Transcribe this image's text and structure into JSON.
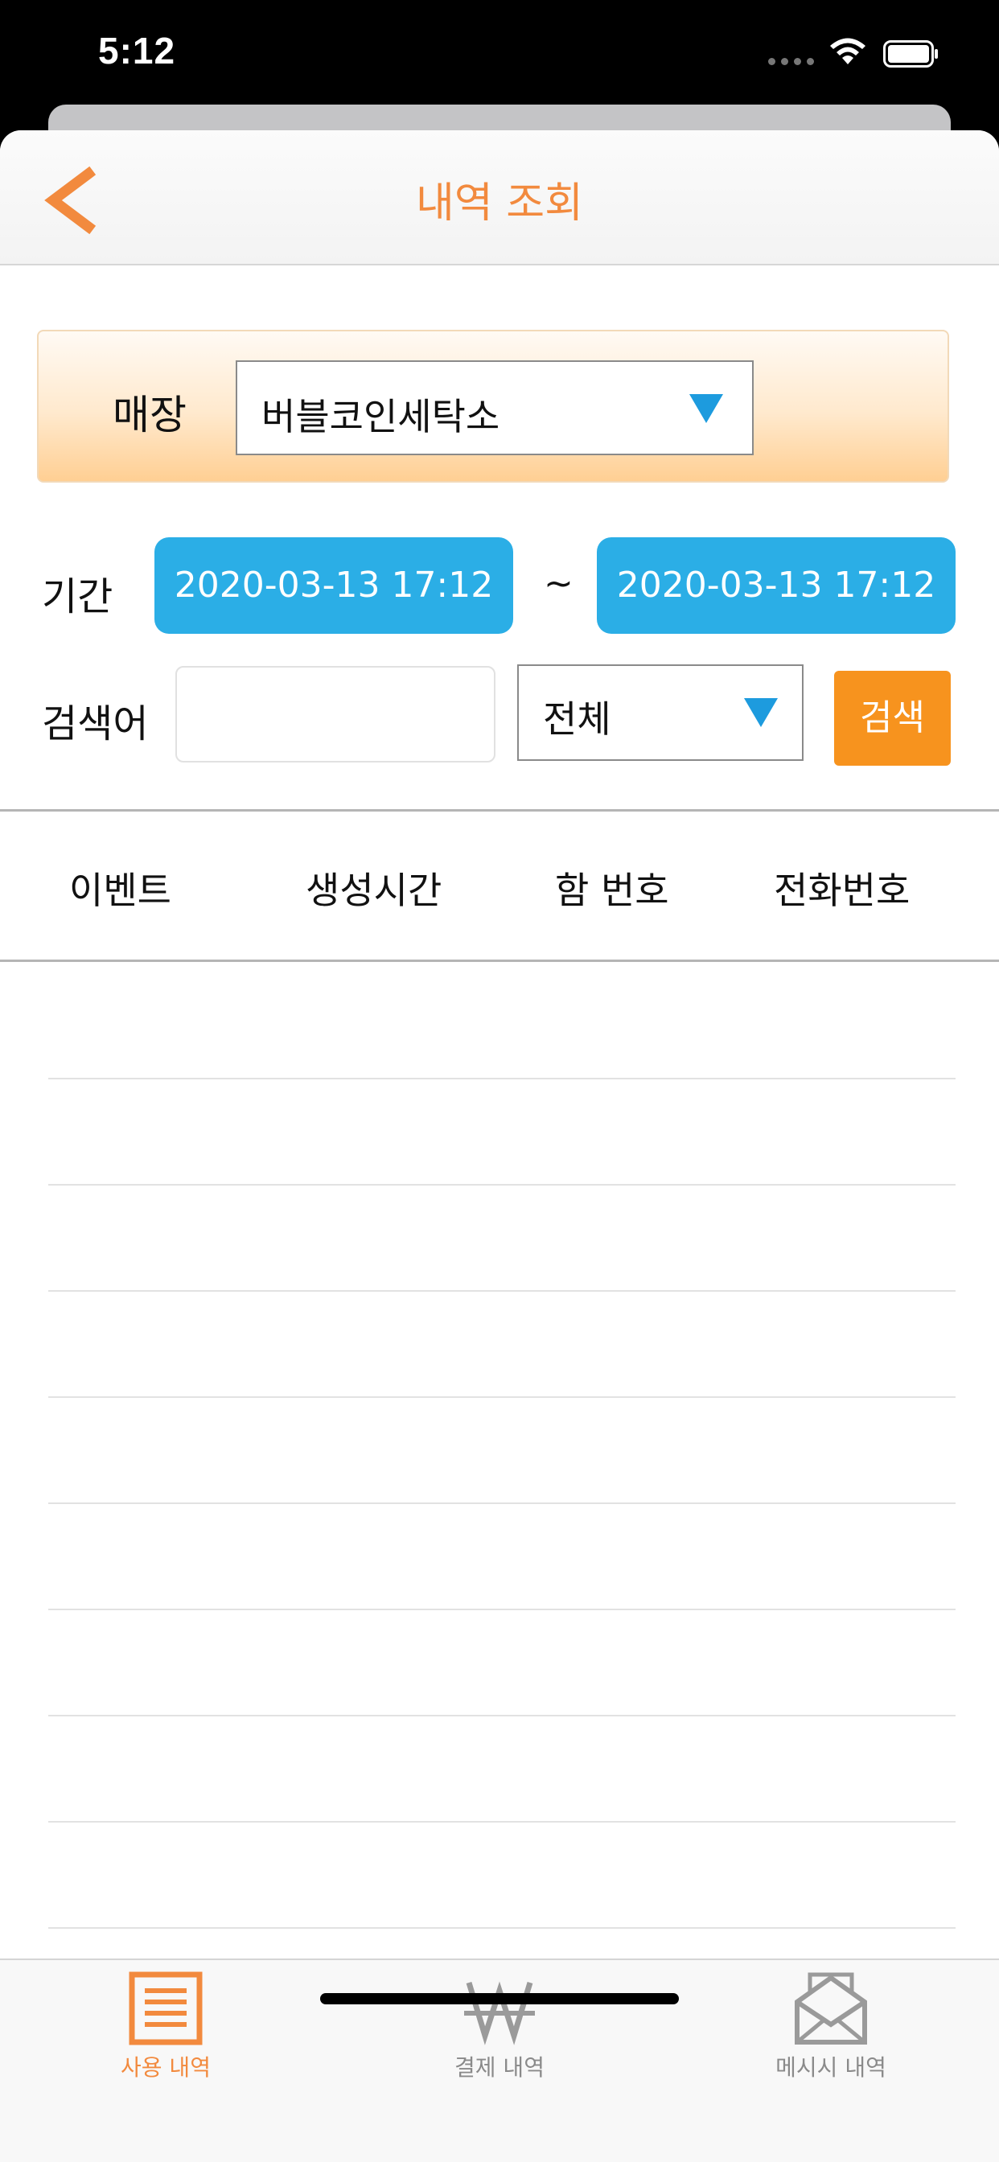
{
  "status_bar": {
    "time": "5:12"
  },
  "nav": {
    "title": "내역 조회"
  },
  "store": {
    "label": "매장",
    "selected": "버블코인세탁소"
  },
  "period": {
    "label": "기간",
    "start": "2020-03-13 17:12",
    "separator": "~",
    "end": "2020-03-13 17:12"
  },
  "search": {
    "label": "검색어",
    "input_value": "",
    "filter_selected": "전체",
    "button_label": "검색"
  },
  "table": {
    "columns": [
      "이벤트",
      "생성시간",
      "함 번호",
      "전화번호"
    ]
  },
  "tabs": [
    {
      "label": "사용 내역",
      "icon": "list-icon",
      "active": true
    },
    {
      "label": "결제 내역",
      "icon": "won-icon",
      "active": false
    },
    {
      "label": "메시시 내역",
      "icon": "envelope-icon",
      "active": false
    }
  ],
  "colors": {
    "accent_orange": "#f28a3e",
    "date_blue": "#2baee6",
    "search_orange": "#f7931e",
    "caret_blue": "#1d9bde"
  }
}
